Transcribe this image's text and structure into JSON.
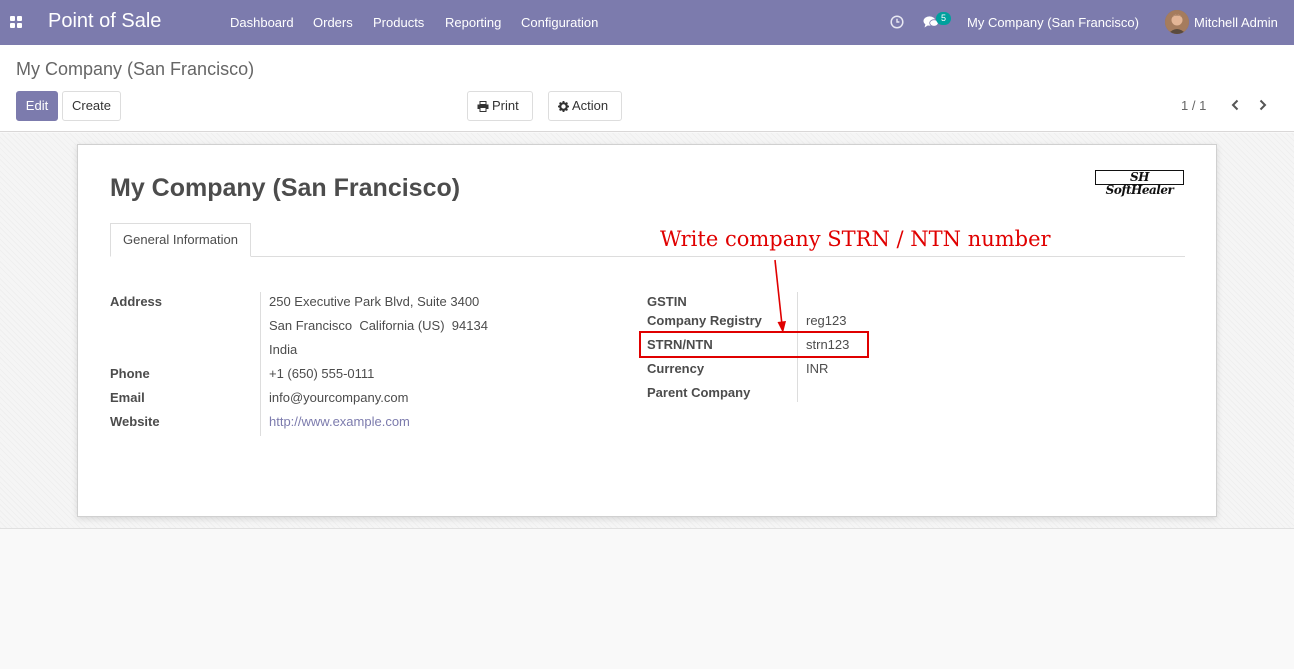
{
  "navbar": {
    "app_title": "Point of Sale",
    "menu": [
      "Dashboard",
      "Orders",
      "Products",
      "Reporting",
      "Configuration"
    ],
    "messages_badge": "5",
    "company_switcher": "My Company (San Francisco)",
    "user_name": "Mitchell Admin",
    "color": "#7c7bad"
  },
  "control_panel": {
    "breadcrumb": "My Company (San Francisco)",
    "edit_label": "Edit",
    "create_label": "Create",
    "print_label": "Print",
    "action_label": "Action",
    "pager": "1 / 1"
  },
  "form": {
    "title": "My Company (San Francisco)",
    "logo_text": "SHSoftHealer",
    "tab_label": "General Information",
    "left_fields": {
      "address_label": "Address",
      "address_line1": "250 Executive Park Blvd, Suite 3400",
      "address_line2": "San Francisco  California (US)  94134",
      "address_line3": "India",
      "phone_label": "Phone",
      "phone_value": "+1 (650) 555-0111",
      "email_label": "Email",
      "email_value": "info@yourcompany.com",
      "website_label": "Website",
      "website_value": "http://www.example.com"
    },
    "right_fields": {
      "gstin_label": "GSTIN",
      "gstin_value": "",
      "registry_label": "Company Registry",
      "registry_value": "reg123",
      "strn_label": "STRN/NTN",
      "strn_value": "strn123",
      "currency_label": "Currency",
      "currency_value": "INR",
      "parent_label": "Parent Company",
      "parent_value": ""
    }
  },
  "annotation": {
    "text": "Write company STRN / NTN number",
    "color": "#e00000"
  }
}
